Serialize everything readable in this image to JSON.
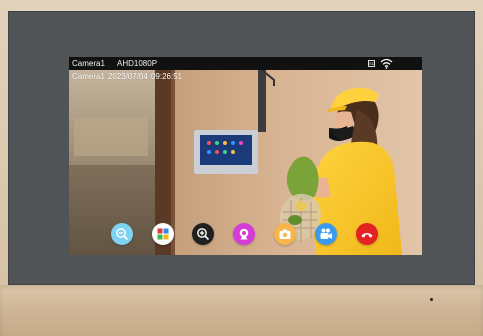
{
  "status_bar": {
    "camera_label": "Camera1",
    "resolution": "AHD1080P",
    "sd_icon": "sd-card-icon",
    "wifi_icon": "wifi-icon"
  },
  "osd": {
    "camera": "Camera1",
    "date": "2023/07/04",
    "time": "09:26:51"
  },
  "controls": [
    {
      "name": "zoom-out-button",
      "icon": "zoom-out-icon",
      "color": "#7fd3f2"
    },
    {
      "name": "apps-button",
      "icon": "apps-grid-icon",
      "color": "#ffffff"
    },
    {
      "name": "zoom-in-button",
      "icon": "zoom-in-icon",
      "color": "#1f1f1f"
    },
    {
      "name": "monitor-button",
      "icon": "webcam-icon",
      "color": "#d63bd9"
    },
    {
      "name": "snapshot-button",
      "icon": "camera-icon",
      "color": "#f6b64b"
    },
    {
      "name": "record-button",
      "icon": "video-camera-icon",
      "color": "#3a9bee"
    },
    {
      "name": "hangup-button",
      "icon": "phone-hangup-icon",
      "color": "#e52222"
    }
  ]
}
